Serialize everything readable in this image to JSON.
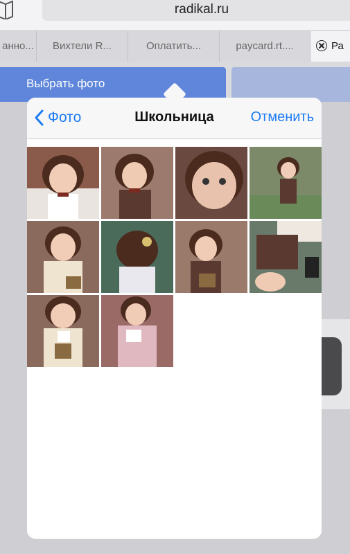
{
  "browser": {
    "address": "radikal.ru",
    "tabs": [
      {
        "label": "анно..."
      },
      {
        "label": "Вихтели R..."
      },
      {
        "label": "Оплатить..."
      },
      {
        "label": "paycard.rt...."
      },
      {
        "label": "Ра"
      }
    ]
  },
  "page": {
    "choose_photo_label": "Выбрать фото"
  },
  "picker": {
    "back_label": "Фото",
    "title": "Школьница",
    "cancel_label": "Отменить",
    "photos": [
      {
        "name": "doll-photo-1"
      },
      {
        "name": "doll-photo-2"
      },
      {
        "name": "doll-photo-3"
      },
      {
        "name": "doll-photo-4"
      },
      {
        "name": "doll-photo-5"
      },
      {
        "name": "doll-photo-6"
      },
      {
        "name": "doll-photo-7"
      },
      {
        "name": "doll-photo-8"
      },
      {
        "name": "doll-photo-9"
      },
      {
        "name": "doll-photo-10"
      }
    ]
  },
  "colors": {
    "accent": "#1e7cf2",
    "choose_button": "#5f86da"
  }
}
